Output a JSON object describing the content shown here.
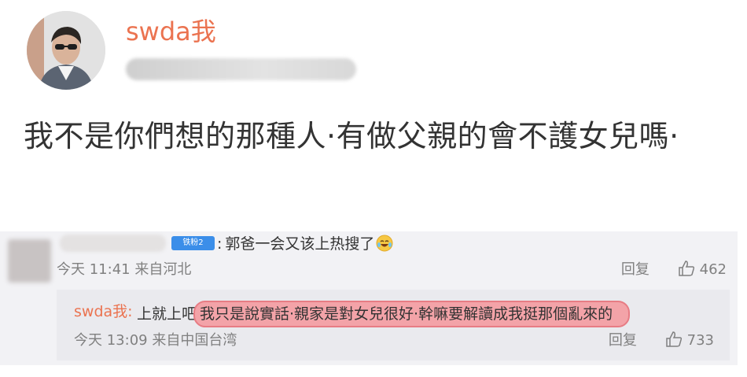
{
  "post": {
    "username": "swda我",
    "text": "我不是你們想的那種人·有做父親的會不護女兒嗎·"
  },
  "comment": {
    "badge": "铁粉2",
    "text": "郭爸一会又该上热搜了",
    "emoji_icon": "laugh-cry-icon",
    "time": "今天 11:41",
    "location": "来自河北",
    "reply_label": "回复",
    "likes": "462"
  },
  "reply": {
    "username": "swda我",
    "text_prefix": "上就上吧",
    "text_highlight": "我只是說實話‧親家是對女兒很好‧幹嘛要解讀成我挺那個亂來的",
    "time": "今天 13:09",
    "location": "来自中国台湾",
    "reply_label": "回复",
    "likes": "733"
  },
  "colors": {
    "username": "#eb7350",
    "highlight": "#f3a3a8",
    "badge": "#3b8ee9",
    "meta": "#808080"
  }
}
